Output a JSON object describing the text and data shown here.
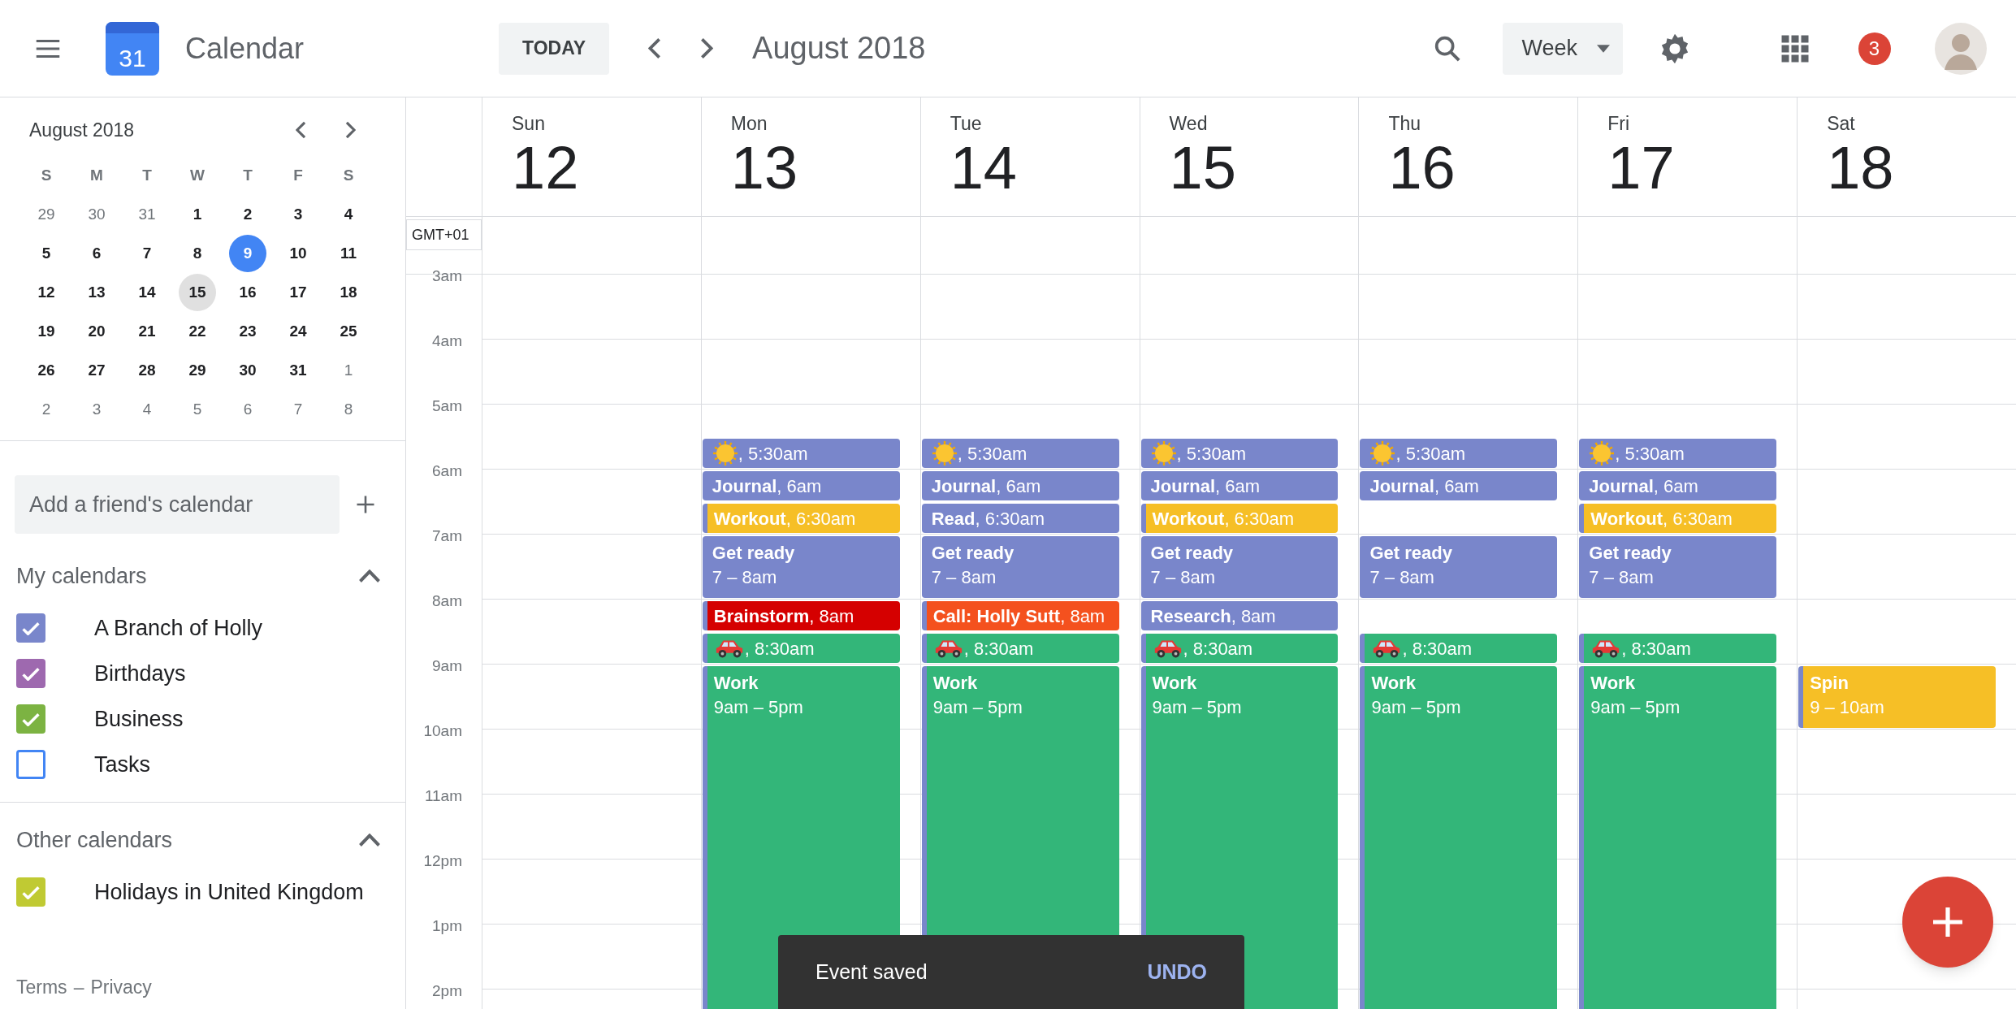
{
  "top_bar": {
    "logo_text": "31",
    "app_title": "Calendar",
    "today_button": "TODAY",
    "period": "August 2018",
    "view_select": "Week",
    "notification_count": "3"
  },
  "mini_calendar": {
    "title": "August 2018",
    "weekdays": [
      "S",
      "M",
      "T",
      "W",
      "T",
      "F",
      "S"
    ],
    "weeks": [
      [
        {
          "label": "29",
          "muted": true,
          "today": false,
          "selected": false
        },
        {
          "label": "30",
          "muted": true,
          "today": false,
          "selected": false
        },
        {
          "label": "31",
          "muted": true,
          "today": false,
          "selected": false
        },
        {
          "label": "1",
          "muted": false,
          "today": false,
          "selected": false
        },
        {
          "label": "2",
          "muted": false,
          "today": false,
          "selected": false
        },
        {
          "label": "3",
          "muted": false,
          "today": false,
          "selected": false
        },
        {
          "label": "4",
          "muted": false,
          "today": false,
          "selected": false
        }
      ],
      [
        {
          "label": "5",
          "muted": false,
          "today": false,
          "selected": false
        },
        {
          "label": "6",
          "muted": false,
          "today": false,
          "selected": false
        },
        {
          "label": "7",
          "muted": false,
          "today": false,
          "selected": false
        },
        {
          "label": "8",
          "muted": false,
          "today": false,
          "selected": false
        },
        {
          "label": "9",
          "muted": false,
          "today": true,
          "selected": false
        },
        {
          "label": "10",
          "muted": false,
          "today": false,
          "selected": false
        },
        {
          "label": "11",
          "muted": false,
          "today": false,
          "selected": false
        }
      ],
      [
        {
          "label": "12",
          "muted": false,
          "today": false,
          "selected": false
        },
        {
          "label": "13",
          "muted": false,
          "today": false,
          "selected": false
        },
        {
          "label": "14",
          "muted": false,
          "today": false,
          "selected": false
        },
        {
          "label": "15",
          "muted": false,
          "today": false,
          "selected": true
        },
        {
          "label": "16",
          "muted": false,
          "today": false,
          "selected": false
        },
        {
          "label": "17",
          "muted": false,
          "today": false,
          "selected": false
        },
        {
          "label": "18",
          "muted": false,
          "today": false,
          "selected": false
        }
      ],
      [
        {
          "label": "19",
          "muted": false,
          "today": false,
          "selected": false
        },
        {
          "label": "20",
          "muted": false,
          "today": false,
          "selected": false
        },
        {
          "label": "21",
          "muted": false,
          "today": false,
          "selected": false
        },
        {
          "label": "22",
          "muted": false,
          "today": false,
          "selected": false
        },
        {
          "label": "23",
          "muted": false,
          "today": false,
          "selected": false
        },
        {
          "label": "24",
          "muted": false,
          "today": false,
          "selected": false
        },
        {
          "label": "25",
          "muted": false,
          "today": false,
          "selected": false
        }
      ],
      [
        {
          "label": "26",
          "muted": false,
          "today": false,
          "selected": false
        },
        {
          "label": "27",
          "muted": false,
          "today": false,
          "selected": false
        },
        {
          "label": "28",
          "muted": false,
          "today": false,
          "selected": false
        },
        {
          "label": "29",
          "muted": false,
          "today": false,
          "selected": false
        },
        {
          "label": "30",
          "muted": false,
          "today": false,
          "selected": false
        },
        {
          "label": "31",
          "muted": false,
          "today": false,
          "selected": false
        },
        {
          "label": "1",
          "muted": true,
          "today": false,
          "selected": false
        }
      ],
      [
        {
          "label": "2",
          "muted": true,
          "today": false,
          "selected": false
        },
        {
          "label": "3",
          "muted": true,
          "today": false,
          "selected": false
        },
        {
          "label": "4",
          "muted": true,
          "today": false,
          "selected": false
        },
        {
          "label": "5",
          "muted": true,
          "today": false,
          "selected": false
        },
        {
          "label": "6",
          "muted": true,
          "today": false,
          "selected": false
        },
        {
          "label": "7",
          "muted": true,
          "today": false,
          "selected": false
        },
        {
          "label": "8",
          "muted": true,
          "today": false,
          "selected": false
        }
      ]
    ]
  },
  "add_calendar": {
    "placeholder": "Add a friend's calendar"
  },
  "calendar_groups": [
    {
      "title": "My calendars",
      "expanded": true,
      "items": [
        {
          "label": "A Branch of Holly",
          "checked": true,
          "color": "#7986cb"
        },
        {
          "label": "Birthdays",
          "checked": true,
          "color": "#9e69af"
        },
        {
          "label": "Business",
          "checked": true,
          "color": "#7cb342"
        },
        {
          "label": "Tasks",
          "checked": false,
          "color": "#4285f4"
        }
      ]
    },
    {
      "title": "Other calendars",
      "expanded": true,
      "items": [
        {
          "label": "Holidays in United Kingdom",
          "checked": true,
          "color": "#c0ca33"
        }
      ]
    }
  ],
  "footer": {
    "terms": "Terms",
    "separator": "–",
    "privacy": "Privacy"
  },
  "week": {
    "timezone": "GMT+01",
    "hours": [
      "3am",
      "4am",
      "5am",
      "6am",
      "7am",
      "8am",
      "9am",
      "10am",
      "11am",
      "12pm",
      "1pm",
      "2pm"
    ],
    "days": [
      {
        "name": "Sun",
        "date": "12"
      },
      {
        "name": "Mon",
        "date": "13",
        "events": [
          {
            "kind": "sun",
            "text": ", 5:30am",
            "color": "#7986cb",
            "stripe": false
          },
          {
            "kind": "line",
            "text": "**Journal**, 6am",
            "color": "#7986cb",
            "stripe": false
          },
          {
            "kind": "line",
            "text": "**Workout**, 6:30am",
            "color": "#f6bf26",
            "stripe": true
          },
          {
            "kind": "block",
            "title": "Get ready",
            "time": "7 – 8am",
            "color": "#7986cb",
            "stripe": false
          },
          {
            "kind": "line",
            "text": "**Brainstorm**, 8am",
            "color": "#d50000",
            "stripe": true
          },
          {
            "kind": "car",
            "text": ", 8:30am",
            "color": "#33b679",
            "stripe": true
          },
          {
            "kind": "block",
            "title": "Work",
            "time": "9am – 5pm",
            "color": "#33b679",
            "stripe": true
          }
        ]
      },
      {
        "name": "Tue",
        "date": "14",
        "events": [
          {
            "kind": "sun",
            "text": ", 5:30am",
            "color": "#7986cb",
            "stripe": false
          },
          {
            "kind": "line",
            "text": "**Journal**, 6am",
            "color": "#7986cb",
            "stripe": false
          },
          {
            "kind": "line",
            "text": "**Read**, 6:30am",
            "color": "#7986cb",
            "stripe": false
          },
          {
            "kind": "block",
            "title": "Get ready",
            "time": "7 – 8am",
            "color": "#7986cb",
            "stripe": false
          },
          {
            "kind": "line",
            "text": "**Call: Holly Sutt**, 8am",
            "color": "#f4511e",
            "stripe": true
          },
          {
            "kind": "car",
            "text": ", 8:30am",
            "color": "#33b679",
            "stripe": true
          },
          {
            "kind": "block",
            "title": "Work",
            "time": "9am – 5pm",
            "color": "#33b679",
            "stripe": true
          }
        ]
      },
      {
        "name": "Wed",
        "date": "15",
        "events": [
          {
            "kind": "sun",
            "text": ", 5:30am",
            "color": "#7986cb",
            "stripe": false
          },
          {
            "kind": "line",
            "text": "**Journal**, 6am",
            "color": "#7986cb",
            "stripe": false
          },
          {
            "kind": "line",
            "text": "**Workout**, 6:30am",
            "color": "#f6bf26",
            "stripe": true
          },
          {
            "kind": "block",
            "title": "Get ready",
            "time": "7 – 8am",
            "color": "#7986cb",
            "stripe": false
          },
          {
            "kind": "line",
            "text": "**Research**, 8am",
            "color": "#7986cb",
            "stripe": false
          },
          {
            "kind": "car",
            "text": ", 8:30am",
            "color": "#33b679",
            "stripe": true
          },
          {
            "kind": "block",
            "title": "Work",
            "time": "9am – 5pm",
            "color": "#33b679",
            "stripe": true
          }
        ]
      },
      {
        "name": "Thu",
        "date": "16",
        "events": [
          {
            "kind": "sun",
            "text": ", 5:30am",
            "color": "#7986cb",
            "stripe": false
          },
          {
            "kind": "line",
            "text": "**Journal**, 6am",
            "color": "#7986cb",
            "stripe": false
          },
          {
            "kind": "block",
            "title": "Get ready",
            "time": "7 – 8am",
            "color": "#7986cb",
            "stripe": false
          },
          {
            "kind": "car",
            "text": ", 8:30am",
            "color": "#33b679",
            "stripe": true
          },
          {
            "kind": "block",
            "title": "Work",
            "time": "9am – 5pm",
            "color": "#33b679",
            "stripe": true
          }
        ]
      },
      {
        "name": "Fri",
        "date": "17",
        "events": [
          {
            "kind": "sun",
            "text": ", 5:30am",
            "color": "#7986cb",
            "stripe": false
          },
          {
            "kind": "line",
            "text": "**Journal**, 6am",
            "color": "#7986cb",
            "stripe": false
          },
          {
            "kind": "line",
            "text": "**Workout**, 6:30am",
            "color": "#f6bf26",
            "stripe": true
          },
          {
            "kind": "block",
            "title": "Get ready",
            "time": "7 – 8am",
            "color": "#7986cb",
            "stripe": false
          },
          {
            "kind": "car",
            "text": ", 8:30am",
            "color": "#33b679",
            "stripe": true
          },
          {
            "kind": "block",
            "title": "Work",
            "time": "9am – 5pm",
            "color": "#33b679",
            "stripe": true
          }
        ]
      },
      {
        "name": "Sat",
        "date": "18",
        "events": [
          {
            "kind": "block",
            "title": "Spin",
            "time": "9 – 10am",
            "color": "#f6bf26",
            "stripe": true
          }
        ]
      }
    ]
  },
  "snackbar": {
    "message": "Event saved",
    "action": "UNDO"
  }
}
